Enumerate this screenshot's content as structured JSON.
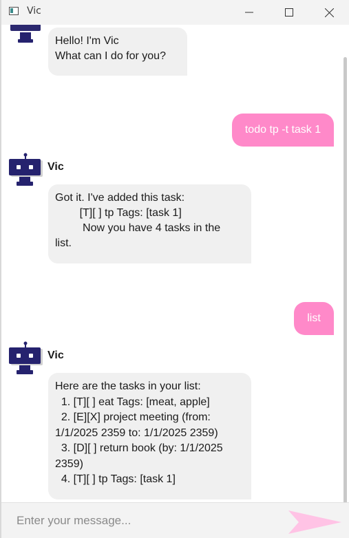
{
  "window": {
    "title": "Vic"
  },
  "colors": {
    "user_bubble": "#ff89c9",
    "bot_bubble": "#f0f0f0",
    "avatar": "#25226e",
    "send_button": "#ffc3e5"
  },
  "messages": [
    {
      "sender": "bot",
      "lines": [
        "Hello! I'm Vic",
        "What can I do for you?"
      ]
    },
    {
      "sender": "user",
      "text": "todo tp -t task 1"
    },
    {
      "sender": "bot",
      "name": "Vic",
      "lines": [
        "Got it. I've added this task:",
        "        [T][ ] tp Tags: [task 1]",
        "         Now you have 4 tasks in the",
        "list."
      ]
    },
    {
      "sender": "user",
      "text": "list"
    },
    {
      "sender": "bot",
      "name": "Vic",
      "lines": [
        "Here are the tasks in your list:",
        "  1. [T][ ] eat Tags: [meat, apple]",
        "  2. [E][X] project meeting (from:",
        "1/1/2025 2359 to: 1/1/2025 2359)",
        "  3. [D][ ] return book (by: 1/1/2025",
        "2359)",
        "  4. [T][ ] tp Tags: [task 1]"
      ]
    }
  ],
  "input": {
    "placeholder": "Enter your message...",
    "send_icon": "send-arrow-icon"
  }
}
